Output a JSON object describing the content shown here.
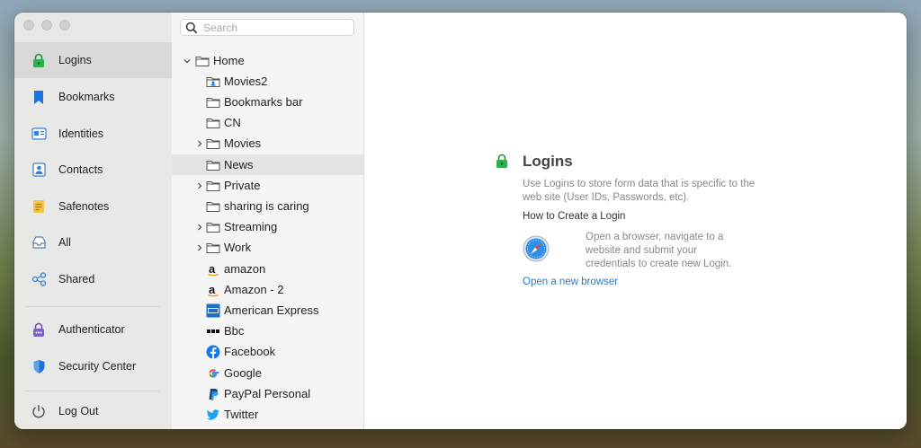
{
  "sidebar": {
    "items": [
      {
        "label": "Logins",
        "icon": "lock-icon",
        "selected": true
      },
      {
        "label": "Bookmarks",
        "icon": "bookmark-icon"
      },
      {
        "label": "Identities",
        "icon": "identity-card-icon"
      },
      {
        "label": "Contacts",
        "icon": "contact-icon"
      },
      {
        "label": "Safenotes",
        "icon": "note-icon"
      },
      {
        "label": "All",
        "icon": "inbox-tray-icon"
      },
      {
        "label": "Shared",
        "icon": "share-nodes-icon"
      },
      {
        "label": "Authenticator",
        "icon": "authenticator-icon"
      },
      {
        "label": "Security Center",
        "icon": "shield-icon"
      },
      {
        "label": "Log Out",
        "icon": "power-icon"
      }
    ]
  },
  "search": {
    "placeholder": "Search"
  },
  "tree": {
    "home": "Home",
    "items": [
      {
        "label": "Movies2",
        "icon": "shared-folder-icon"
      },
      {
        "label": "Bookmarks bar",
        "icon": "folder-icon"
      },
      {
        "label": "CN",
        "icon": "folder-icon"
      },
      {
        "label": "Movies",
        "icon": "folder-icon",
        "expandable": true
      },
      {
        "label": "News",
        "icon": "folder-icon",
        "selected": true
      },
      {
        "label": "Private",
        "icon": "folder-icon",
        "expandable": true
      },
      {
        "label": "sharing is caring",
        "icon": "folder-icon"
      },
      {
        "label": "Streaming",
        "icon": "folder-icon",
        "expandable": true
      },
      {
        "label": "Work",
        "icon": "folder-icon",
        "expandable": true
      },
      {
        "label": "amazon",
        "icon": "amazon-icon"
      },
      {
        "label": "Amazon - 2",
        "icon": "amazon-icon"
      },
      {
        "label": "American Express",
        "icon": "amex-icon"
      },
      {
        "label": "Bbc",
        "icon": "bbc-icon"
      },
      {
        "label": "Facebook",
        "icon": "facebook-icon"
      },
      {
        "label": "Google",
        "icon": "google-icon"
      },
      {
        "label": "PayPal Personal",
        "icon": "paypal-icon"
      },
      {
        "label": "Twitter",
        "icon": "twitter-icon"
      }
    ]
  },
  "main": {
    "title": "Logins",
    "description": "Use Logins to store form data that is specific to the web site (User IDs, Passwords, etc).",
    "howto_heading": "How to Create a Login",
    "instruction": "Open a browser, navigate to a website and submit your credentials to create new Login.",
    "link": "Open a new browser"
  },
  "colors": {
    "accent": "#1f7bd6",
    "lock_green": "#2bb24c"
  }
}
